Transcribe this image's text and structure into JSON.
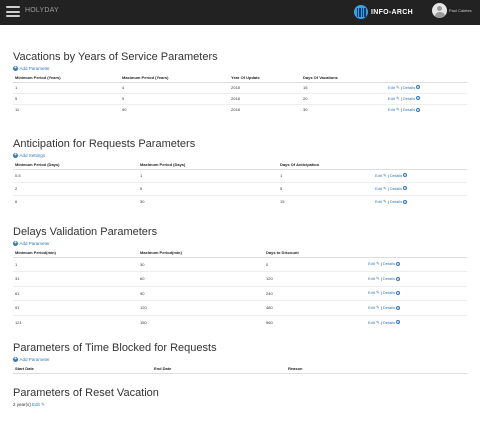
{
  "navbar": {
    "brand": "HOLYDAY",
    "logo_text": "INFO-ARCH",
    "user_name": "Paul Caletes"
  },
  "common": {
    "edit_label": "Edit",
    "details_label": "Details",
    "separator": "|"
  },
  "vacations": {
    "title": "Vacations by Years of Service Parameters",
    "add_label": "Add Parameter",
    "columns": [
      "Minimum Period (Years)",
      "Maximum Period (Years)",
      "Year Of Update",
      "Days Of Vacations"
    ],
    "rows": [
      [
        "1",
        "4",
        "2018",
        "15"
      ],
      [
        "5",
        "9",
        "2018",
        "20"
      ],
      [
        "11",
        "90",
        "2018",
        "30"
      ]
    ]
  },
  "anticipation": {
    "title": "Anticipation for Requests Parameters",
    "add_label": "Add Settings",
    "columns": [
      "Minimum Period (Days)",
      "Maximum Period (Days)",
      "Days Of Anticipation"
    ],
    "rows": [
      [
        "0.5",
        "1",
        "1"
      ],
      [
        "2",
        "5",
        "5"
      ],
      [
        "6",
        "30",
        "15"
      ]
    ]
  },
  "delays": {
    "title": "Delays Validation Parameters",
    "add_label": "Add Parameter",
    "columns": [
      "Minimum Period(min)",
      "Maximum Period(min)",
      "Days to Discount"
    ],
    "rows": [
      [
        "1",
        "30",
        "0"
      ],
      [
        "31",
        "60",
        "120"
      ],
      [
        "61",
        "90",
        "240"
      ],
      [
        "91",
        "120",
        "480"
      ],
      [
        "121",
        "150",
        "960"
      ]
    ]
  },
  "time_blocked": {
    "title": "Parameters of Time Blocked for Requests",
    "add_label": "Add Parameter",
    "columns": [
      "Start Date",
      "End Date",
      "Reason"
    ]
  },
  "reset": {
    "title": "Parameters of Reset Vacation",
    "value": "2 year(s)",
    "edit_label": "Edit"
  }
}
